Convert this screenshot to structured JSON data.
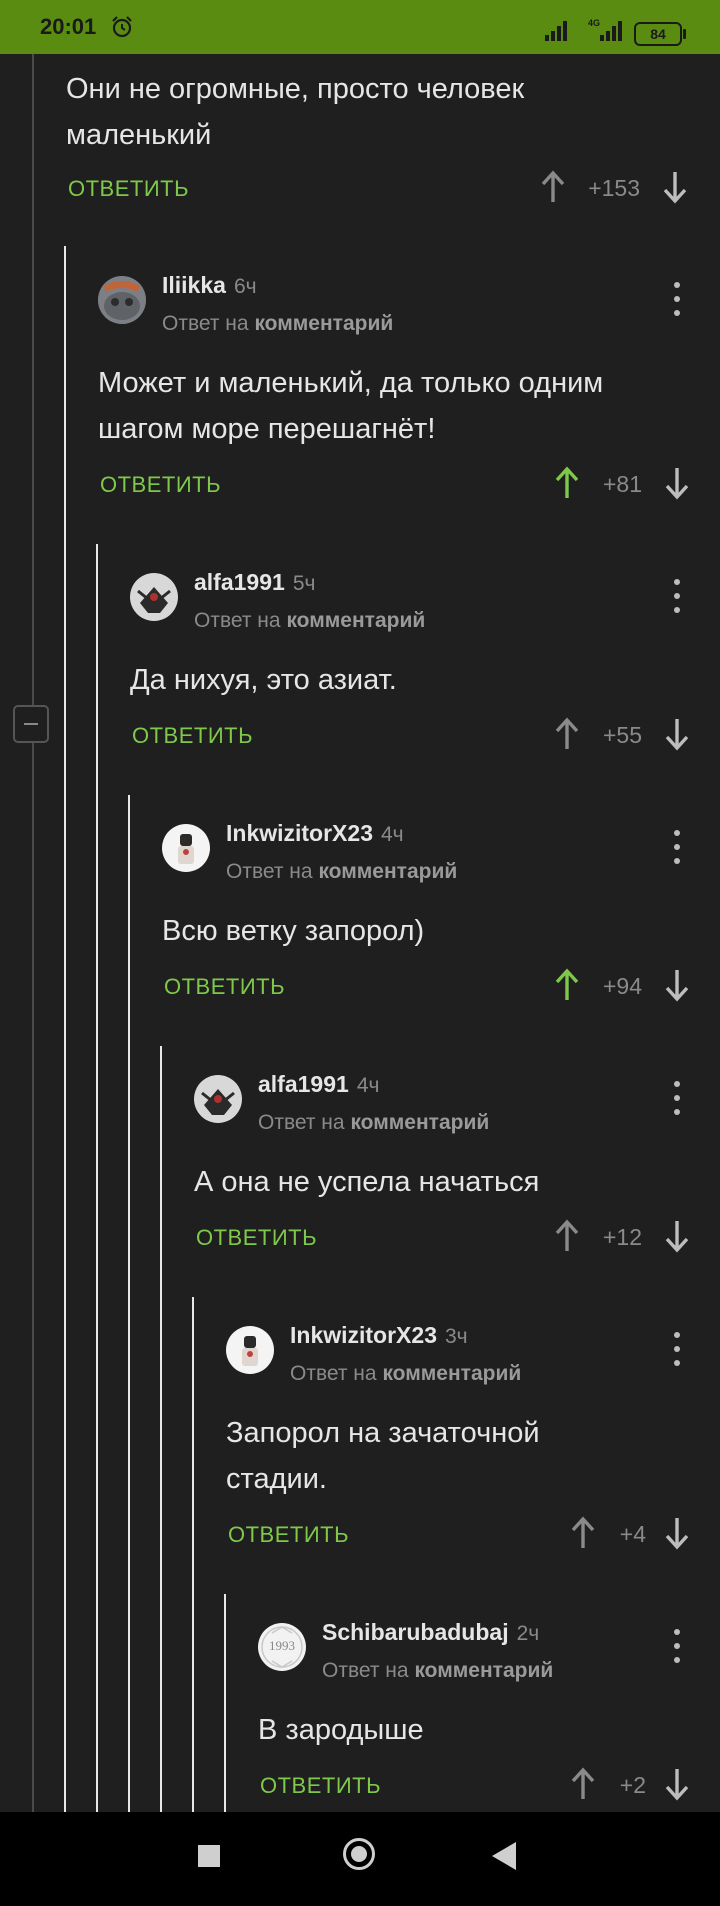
{
  "status": {
    "time": "20:01",
    "network": "4G",
    "battery": "84"
  },
  "top_comment": {
    "text_line1": "Они не огромные, просто человек",
    "text_line2": "маленький",
    "reply_label": "ОТВЕТИТЬ",
    "score": "+153"
  },
  "comments": [
    {
      "username": "Iliikka",
      "time": "6ч",
      "reply_prefix": "Ответ на",
      "reply_target": "комментарий",
      "text_line1": "Может и маленький, да только одним",
      "text_line2": "шагом море перешагнёт!",
      "reply_label": "ОТВЕТИТЬ",
      "score": "+81",
      "upvoted": true
    },
    {
      "username": "alfa1991",
      "time": "5ч",
      "reply_prefix": "Ответ на",
      "reply_target": "комментарий",
      "text_line1": "Да нихуя, это азиат.",
      "text_line2": "",
      "reply_label": "ОТВЕТИТЬ",
      "score": "+55",
      "upvoted": false
    },
    {
      "username": "InkwizitorX23",
      "time": "4ч",
      "reply_prefix": "Ответ на",
      "reply_target": "комментарий",
      "text_line1": "Всю ветку запорол)",
      "text_line2": "",
      "reply_label": "ОТВЕТИТЬ",
      "score": "+94",
      "upvoted": true
    },
    {
      "username": "alfa1991",
      "time": "4ч",
      "reply_prefix": "Ответ на",
      "reply_target": "комментарий",
      "text_line1": "А она не успела начаться",
      "text_line2": "",
      "reply_label": "ОТВЕТИТЬ",
      "score": "+12",
      "upvoted": false
    },
    {
      "username": "InkwizitorX23",
      "time": "3ч",
      "reply_prefix": "Ответ на",
      "reply_target": "комментарий",
      "text_line1": "Запорол на зачаточной",
      "text_line2": "стадии.",
      "reply_label": "ОТВЕТИТЬ",
      "score": "+4",
      "upvoted": false
    },
    {
      "username": "Schibarubadubaj",
      "time": "2ч",
      "reply_prefix": "Ответ на",
      "reply_target": "комментарий",
      "avatar_text": "1993",
      "text_line1": "В зародыше",
      "text_line2": "",
      "reply_label": "ОТВЕТИТЬ",
      "score": "+2",
      "upvoted": false
    }
  ],
  "colors": {
    "accent": "#7fc94a",
    "statusbar": "#5b8c12",
    "background": "#1f1f1f"
  },
  "icons": [
    "alarm-icon",
    "signal-icon",
    "battery-icon",
    "more-vertical-icon",
    "arrow-up-icon",
    "arrow-down-icon",
    "collapse-icon",
    "nav-recents-icon",
    "nav-home-icon",
    "nav-back-icon"
  ]
}
